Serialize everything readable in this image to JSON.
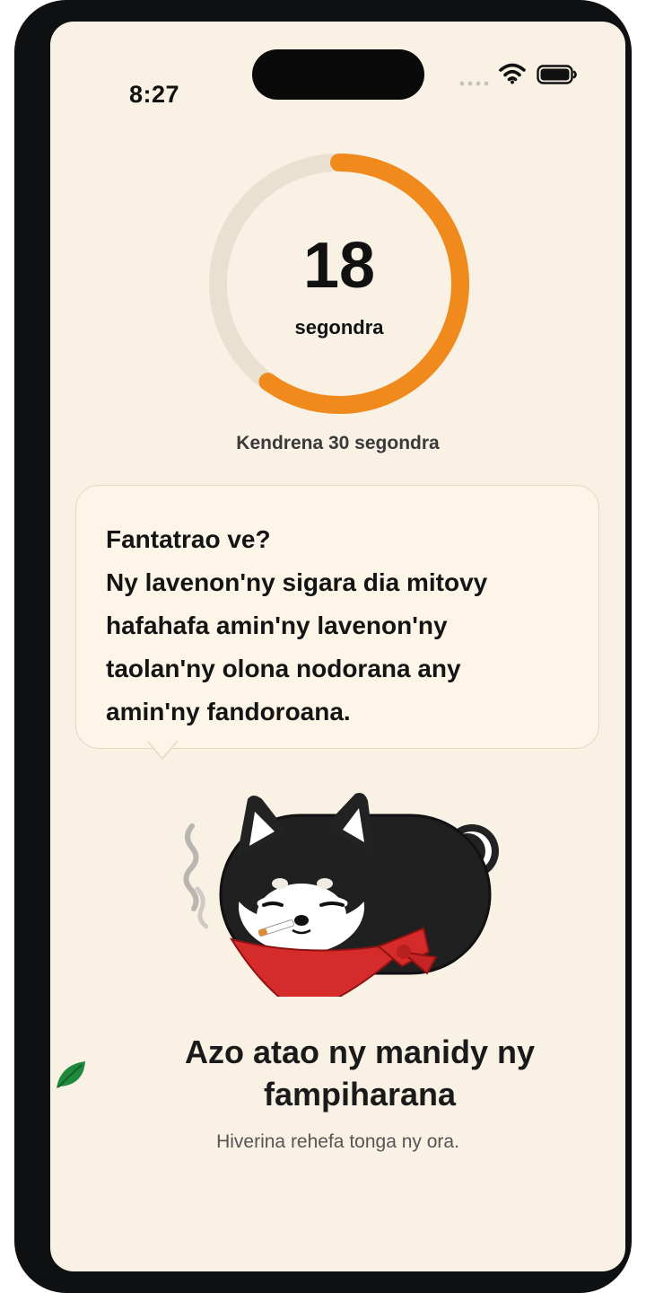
{
  "status_bar": {
    "time": "8:27"
  },
  "timer": {
    "value": "18",
    "unit": "segondra",
    "progress_fraction": 0.6,
    "progress_color": "#f08a1d",
    "track_color": "#e8e0d0",
    "goal_text": "Kendrena 30 segondra"
  },
  "fact_bubble": {
    "lines": [
      "Fantatrao ve?",
      "Ny lavenon'ny sigara dia mitovy",
      "hafahafa amin'ny lavenon'ny",
      "taolan'ny olona nodorana any",
      "amin'ny fandoroana."
    ]
  },
  "mascot": {
    "icon": "smoking-dog-mascot",
    "scarf_color": "#d62b2b"
  },
  "leaf": {
    "icon": "leaf-icon",
    "color": "#1f8a3c"
  },
  "footer": {
    "headline": "Azo atao ny manidy ny fampiharana",
    "subtitle": "Hiverina rehefa tonga ny ora."
  }
}
